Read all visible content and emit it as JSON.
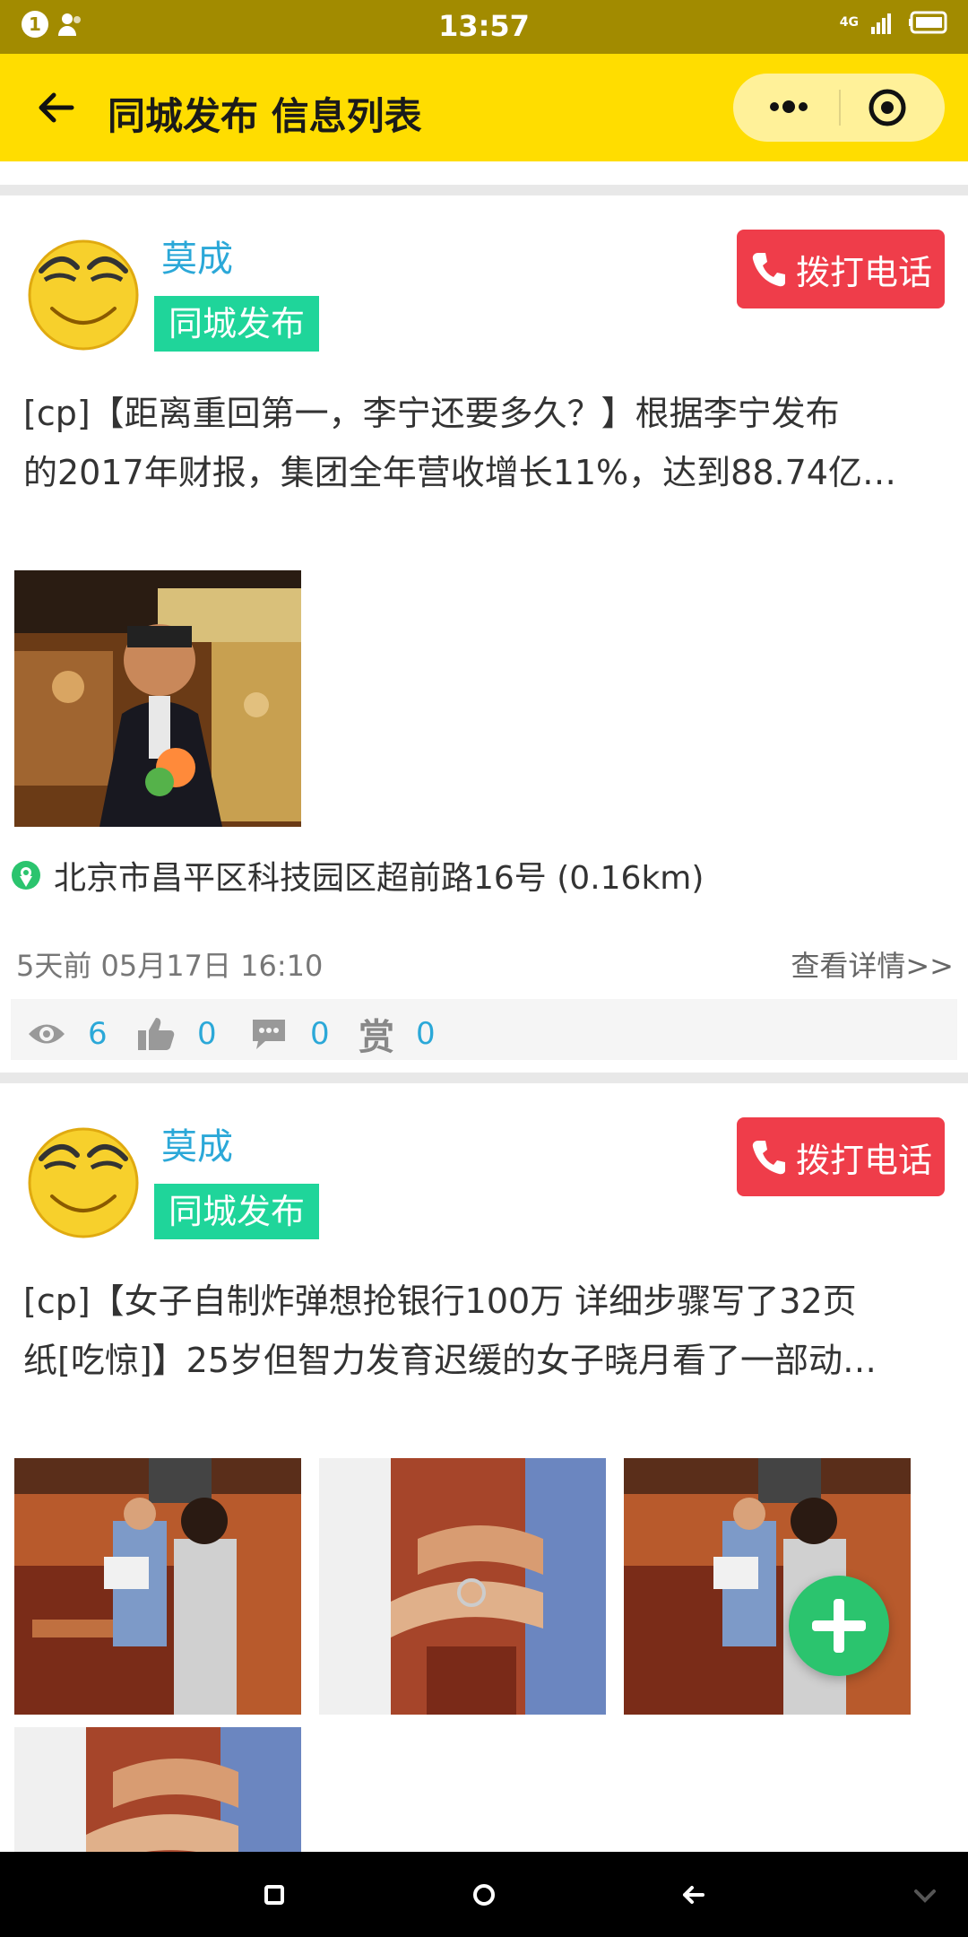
{
  "status_bar": {
    "notification_count": "1",
    "time": "13:57",
    "network": "4G"
  },
  "nav": {
    "title": "同城发布 信息列表"
  },
  "posts": [
    {
      "poster": "莫成",
      "category": "同城发布",
      "call_label": "拨打电话",
      "text_line1": "[cp]【距离重回第一，李宁还要多久？】根据李宁发布",
      "text_line2": "的2017年财报，集团全年营收增长11%，达到88.74亿…",
      "images": [
        "李宁 portrait"
      ],
      "location": "北京市昌平区科技园区超前路16号 (0.16km)",
      "time": "5天前 05月17日 16:10",
      "detail_label": "查看详情>>",
      "views": "6",
      "likes": "0",
      "comments": "0",
      "rewards": "0",
      "reward_glyph": "赏"
    },
    {
      "poster": "莫成",
      "category": "同城发布",
      "call_label": "拨打电话",
      "text_line1": "[cp]【女子自制炸弹想抢银行100万 详细步骤写了32页",
      "text_line2": "纸[吃惊]】25岁但智力发育迟缓的女子晓月看了一部动…",
      "images": [
        "courtroom 1",
        "handcuffs 1",
        "courtroom 2",
        "handcuffs 2"
      ]
    }
  ],
  "colors": {
    "status_bar": "#a28b00",
    "nav_bar": "#ffdd00",
    "category_tag": "#1fd59a",
    "call_button": "#ef3d4a",
    "poster_name": "#2ba8d8",
    "fab": "#2bc46e"
  },
  "icons": [
    "back-arrow-icon",
    "more-dots-icon",
    "target-icon",
    "phone-icon",
    "location-pin-icon",
    "eye-icon",
    "thumbs-up-icon",
    "comment-icon",
    "plus-icon",
    "square-icon",
    "circle-home-icon",
    "back-triangle-icon"
  ]
}
